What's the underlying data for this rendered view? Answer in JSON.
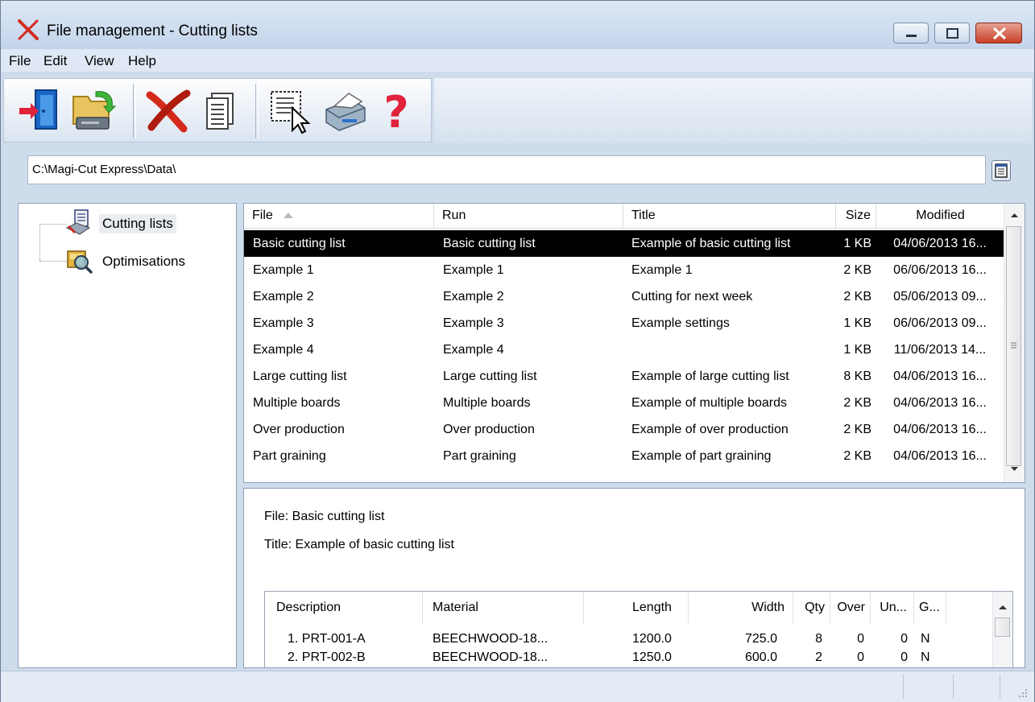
{
  "window": {
    "title": "File management - Cutting lists"
  },
  "menu": [
    "File",
    "Edit",
    "View",
    "Help"
  ],
  "toolbar": {
    "tools": [
      "open-icon",
      "open-folder-icon",
      "delete-icon",
      "copy-icon",
      "select-icon",
      "print-icon",
      "help-icon"
    ]
  },
  "path": {
    "value": "C:\\Magi-Cut Express\\Data\\"
  },
  "tree": {
    "items": [
      {
        "label": "Cutting lists",
        "icon": "cutting-lists-icon"
      },
      {
        "label": "Optimisations",
        "icon": "optimisations-icon"
      }
    ]
  },
  "filelist": {
    "headers": {
      "file": "File",
      "run": "Run",
      "title": "Title",
      "size": "Size",
      "modified": "Modified"
    },
    "rows": [
      {
        "file": "Basic cutting list",
        "run": "Basic cutting list",
        "title": "Example of basic cutting list",
        "size": "1 KB",
        "modified": "04/06/2013 16..."
      },
      {
        "file": "Example 1",
        "run": "Example 1",
        "title": "Example 1",
        "size": "2 KB",
        "modified": "06/06/2013 16..."
      },
      {
        "file": "Example 2",
        "run": "Example 2",
        "title": "Cutting for next week",
        "size": "2 KB",
        "modified": "05/06/2013 09..."
      },
      {
        "file": "Example 3",
        "run": "Example 3",
        "title": "Example settings",
        "size": "1 KB",
        "modified": "06/06/2013 09..."
      },
      {
        "file": "Example 4",
        "run": "Example 4",
        "title": "",
        "size": "1 KB",
        "modified": "11/06/2013 14..."
      },
      {
        "file": "Large cutting list",
        "run": "Large cutting list",
        "title": "Example of large cutting list",
        "size": "8 KB",
        "modified": "04/06/2013 16..."
      },
      {
        "file": "Multiple boards",
        "run": "Multiple boards",
        "title": "Example of multiple boards",
        "size": "2 KB",
        "modified": "04/06/2013 16..."
      },
      {
        "file": "Over production",
        "run": "Over production",
        "title": "Example of over production",
        "size": "2 KB",
        "modified": "04/06/2013 16..."
      },
      {
        "file": "Part graining",
        "run": "Part graining",
        "title": "Example of part graining",
        "size": "2 KB",
        "modified": "04/06/2013 16..."
      }
    ]
  },
  "details": {
    "file_line": "File: Basic cutting list",
    "title_line": "Title: Example of basic cutting list",
    "parts": {
      "headers": {
        "description": "Description",
        "material": "Material",
        "length": "Length",
        "width": "Width",
        "qty": "Qty",
        "over": "Over",
        "under": "Un...",
        "grain": "G..."
      },
      "rows": [
        {
          "description": "1. PRT-001-A",
          "material": "BEECHWOOD-18...",
          "length": "1200.0",
          "width": "725.0",
          "qty": "8",
          "over": "0",
          "under": "0",
          "grain": "N"
        },
        {
          "description": "2. PRT-002-B",
          "material": "BEECHWOOD-18...",
          "length": "1250.0",
          "width": "600.0",
          "qty": "2",
          "over": "0",
          "under": "0",
          "grain": "N"
        }
      ]
    }
  },
  "colors": {
    "chrome": "#cfdcec",
    "selection": "#000000",
    "accent_red": "#d42a1c"
  }
}
